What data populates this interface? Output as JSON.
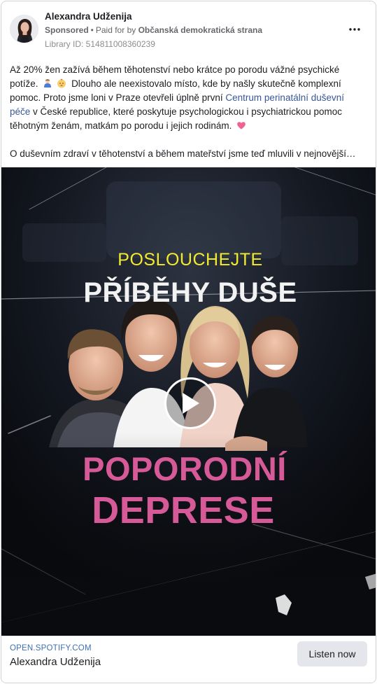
{
  "post": {
    "page_name": "Alexandra Udženija",
    "sponsored_label": "Sponsored",
    "separator": "•",
    "paid_for_prefix": "Paid for by",
    "paid_for_name": "Občanská demokratická strana",
    "library_id": "Library ID: 514811008360239"
  },
  "body": {
    "p1_a": "Až 20% žen zažívá během těhotenství nebo krátce po porodu vážné psychické potíže.",
    "p1_b": "Dlouho ale neexistovalo místo, kde by našly skutečně komplexní pomoc. Proto jsme loni v Praze otevřeli úplně první",
    "p1_link": "Centrum perinatální duševní péče",
    "p1_c": "v České republice, které poskytuje psychologickou i psychiatrickou pomoc těhotným ženám, matkám po porodu i jejich rodinám.",
    "p2": "O duševním zdraví v těhotenství a během mateřství jsme teď mluvili v nejnovější…"
  },
  "media": {
    "line1": "POSLOUCHEJTE",
    "line2": "PŘÍBĚHY DUŠE",
    "line3": "POPORODNÍ",
    "line4": "DEPRESE",
    "accent_yellow": "#f3ea2e",
    "accent_pink": "#d65a97"
  },
  "footer": {
    "domain": "OPEN.SPOTIFY.COM",
    "title": "Alexandra Udženija",
    "cta_label": "Listen now"
  },
  "icons": {
    "more": "three-dots-icon",
    "play": "play-icon",
    "emoji1": "person-bowing-emoji",
    "emoji2": "baby-face-emoji",
    "emoji3": "pink-heart-emoji"
  }
}
